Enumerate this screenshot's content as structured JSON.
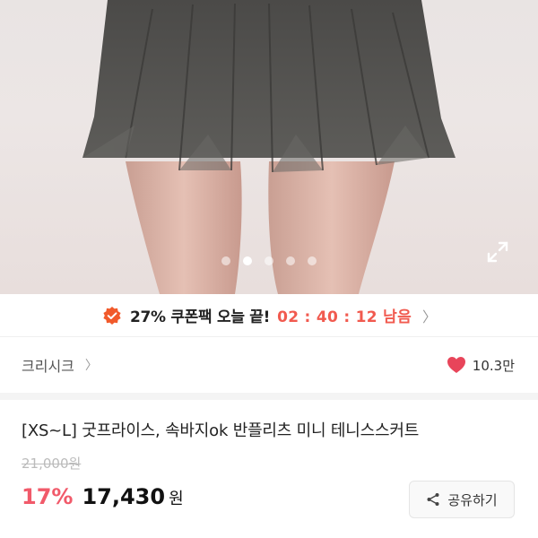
{
  "gallery": {
    "slide_count": 5,
    "active_index": 1,
    "expand_icon": "expand-icon"
  },
  "coupon": {
    "icon": "badge-check-icon",
    "text": "27% 쿠폰팩 오늘 끝!",
    "timer": "02 : 40 : 12 남음",
    "arrow_icon": "chevron-right-icon",
    "accent_color": "#f15a4f"
  },
  "seller": {
    "name": "크리시크",
    "chevron_icon": "chevron-right-icon"
  },
  "likes": {
    "icon": "heart-icon",
    "count": "10.3만",
    "color": "#e8455a"
  },
  "product": {
    "title": "[XS~L] 굿프라이스, 속바지ok 반플리츠 미니 테니스스커트",
    "original_price": "21,000원",
    "discount": "17%",
    "price": "17,430",
    "currency": "원",
    "discount_color": "#f15a6a"
  },
  "share": {
    "icon": "share-icon",
    "label": "공유하기"
  }
}
